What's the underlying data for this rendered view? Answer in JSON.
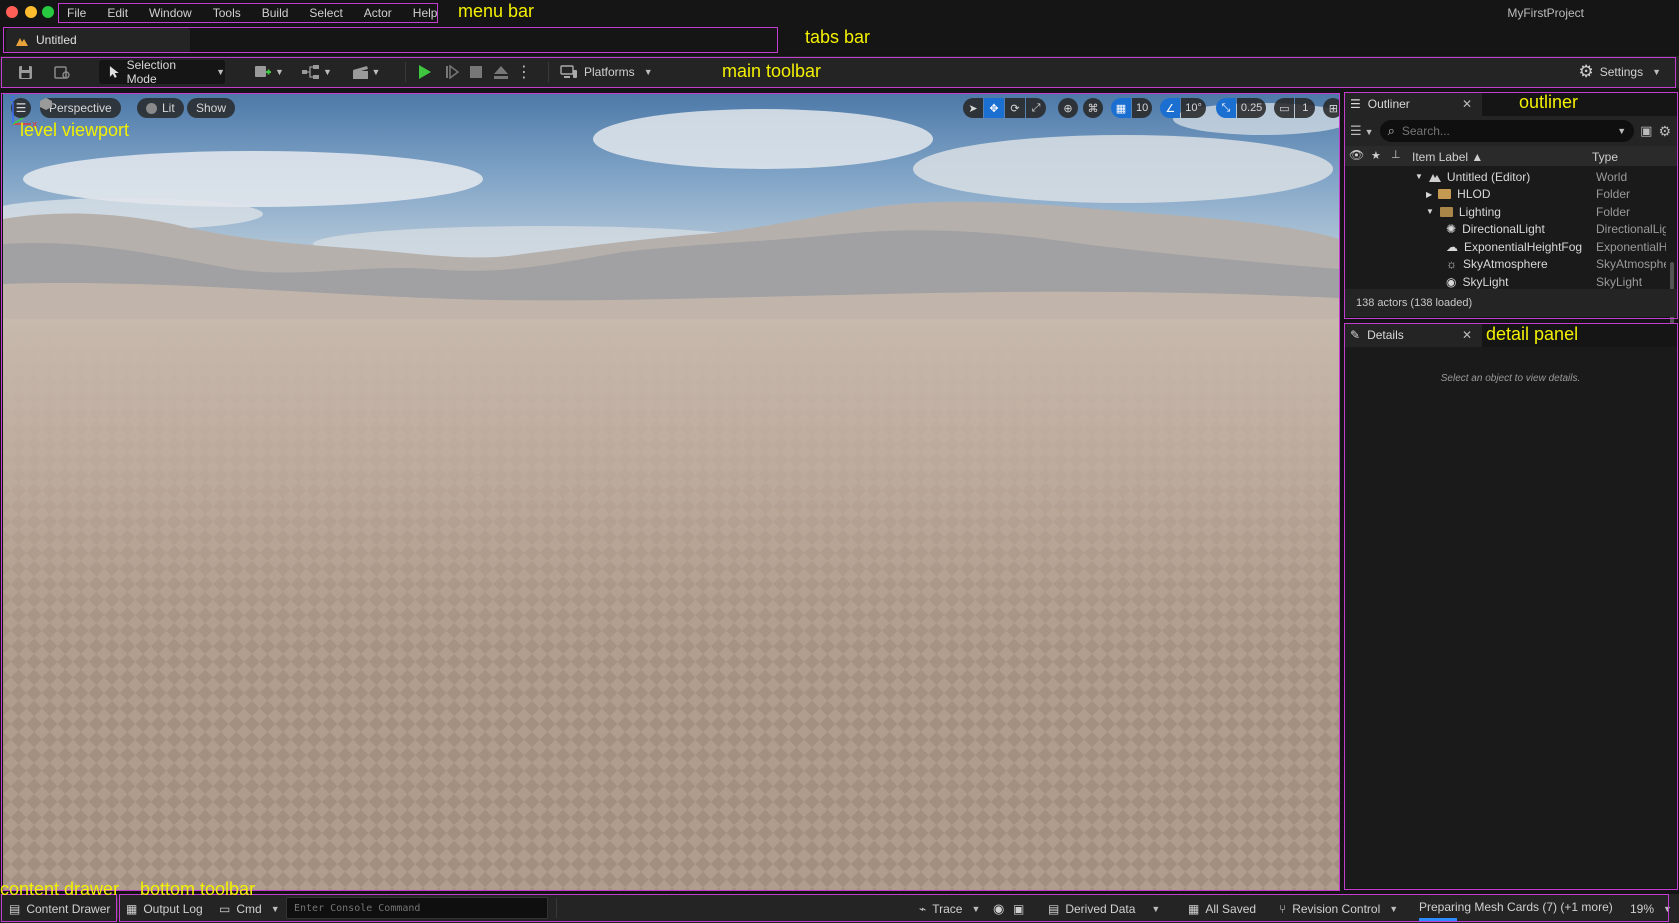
{
  "annotations": {
    "menu_bar": "menu bar",
    "tabs_bar": "tabs bar",
    "main_toolbar": "main toolbar",
    "level_viewport": "level viewport",
    "outliner": "outliner",
    "detail_panel": "detail panel",
    "content_drawer": "content drawer",
    "bottom_toolbar": "bottom toolbar"
  },
  "menu": [
    "File",
    "Edit",
    "Window",
    "Tools",
    "Build",
    "Select",
    "Actor",
    "Help"
  ],
  "project_name": "MyFirstProject",
  "tab": {
    "label": "Untitled"
  },
  "toolbar": {
    "selection_mode": "Selection Mode",
    "platforms": "Platforms",
    "settings": "Settings"
  },
  "viewport": {
    "perspective": "Perspective",
    "lit": "Lit",
    "show": "Show",
    "grid_snap": "10",
    "rotation_snap": "10°",
    "scale_snap": "0.25",
    "camera_speed": "1"
  },
  "outliner": {
    "title": "Outliner",
    "search_placeholder": "Search...",
    "col_label": "Item Label ▲",
    "col_type": "Type",
    "rows": [
      {
        "name": "Untitled (Editor)",
        "type": "World"
      },
      {
        "name": "HLOD",
        "type": "Folder"
      },
      {
        "name": "Lighting",
        "type": "Folder"
      },
      {
        "name": "DirectionalLight",
        "type": "DirectionalLight"
      },
      {
        "name": "ExponentialHeightFog",
        "type": "ExponentialHeightFog"
      },
      {
        "name": "SkyAtmosphere",
        "type": "SkyAtmosphere"
      },
      {
        "name": "SkyLight",
        "type": "SkyLight"
      }
    ],
    "footer": "138 actors (138 loaded)"
  },
  "details": {
    "title": "Details",
    "empty_message": "Select an object to view details."
  },
  "bottombar": {
    "content_drawer": "Content Drawer",
    "output_log": "Output Log",
    "cmd": "Cmd",
    "console_placeholder": "Enter Console Command",
    "trace": "Trace",
    "derived_data": "Derived Data",
    "all_saved": "All Saved",
    "revision_control": "Revision Control",
    "task": "Preparing Mesh Cards (7) (+1 more)",
    "task_percent": "19%",
    "task_progress": 0.19
  },
  "colors": {
    "accent_blue": "#1b6fd1",
    "play_green": "#3fc63f",
    "annotation_border": "#c43cd0",
    "annotation_text": "#f3f000"
  }
}
